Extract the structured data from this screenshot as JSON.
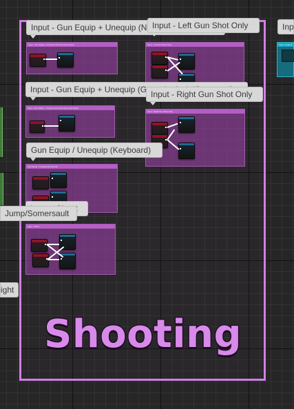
{
  "group": {
    "title": "Shooting",
    "color": "#d27fe6"
  },
  "comments": [
    {
      "id": "gun-equip-normal",
      "header": "Input - Gun Equip + Unequip (Normal) (Gamepad)",
      "bubble": "Input - Gun Equip + Unequip (Normal) (Gamepad)"
    },
    {
      "id": "gun-equip-gunspinning",
      "header": "Input - Gun Equip + Unequip (Gunspinning) (Gamepad)",
      "bubble": "Input - Gun Equip + Unequip (Gunspinning) (Gamepad)"
    },
    {
      "id": "gun-equip-keyboard",
      "header": "Gun Equip / Unequip (Keyboard)",
      "bubble": "Gun Equip / Unequip (Keyboard)"
    },
    {
      "id": "shoot",
      "header": "Input - Shoot",
      "bubble": "Input - Shoot"
    },
    {
      "id": "left-gun-shot",
      "header": "Input - Left Gun Shot Only",
      "bubble": "Input - Left Gun Shot Only"
    },
    {
      "id": "right-gun-shot",
      "header": "Input - Right Gun Shot Only",
      "bubble": "Input - Right Gun Shot Only"
    }
  ],
  "offscreen": {
    "left_bubble_jump": "Jump/Somersault",
    "left_bubble_bottom": "ight",
    "right_bubble_top": "Inp",
    "right_node_header": "Input - Explore"
  }
}
